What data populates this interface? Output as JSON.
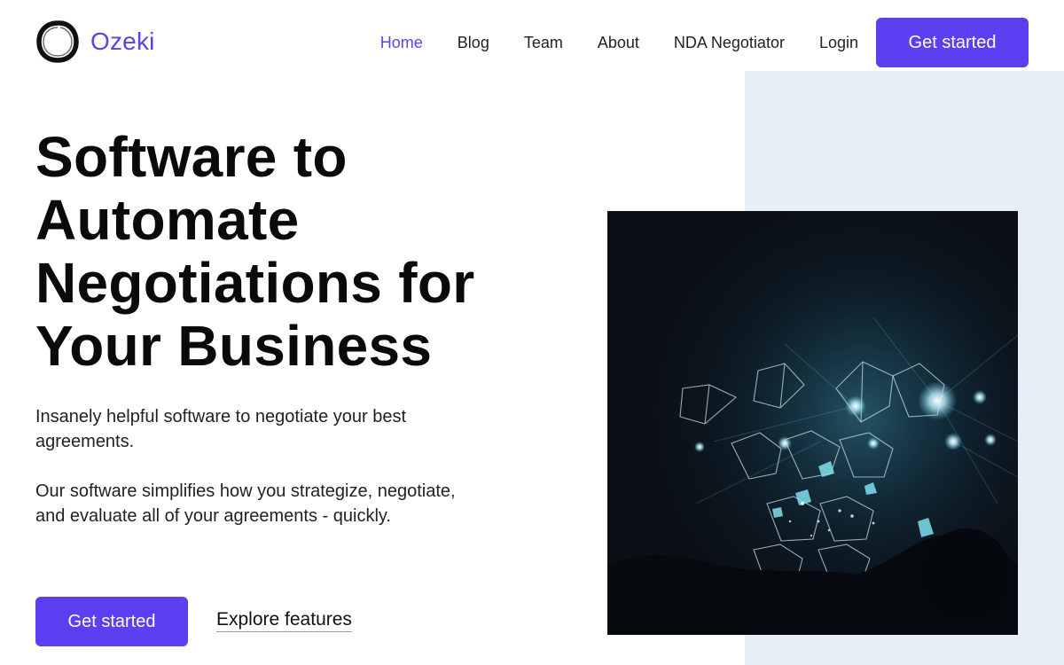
{
  "brand": {
    "name": "Ozeki",
    "logo_icon": "enso-circle-icon",
    "accent_color": "#5b3ff0"
  },
  "nav": {
    "items": [
      {
        "label": "Home",
        "active": true
      },
      {
        "label": "Blog",
        "active": false
      },
      {
        "label": "Team",
        "active": false
      },
      {
        "label": "About",
        "active": false
      },
      {
        "label": "NDA Negotiator",
        "active": false
      },
      {
        "label": "Login",
        "active": false
      }
    ],
    "cta_label": "Get started"
  },
  "hero": {
    "title": "Software to Automate Negotiations for Your Business",
    "subtitle": "Insanely helpful software to negotiate your best agreements.",
    "description": "Our software simplifies how you strategize, negotiate, and evaluate all of your agreements - quickly.",
    "primary_cta": "Get started",
    "secondary_cta": "Explore features",
    "image": "concert-light-installation-photo"
  },
  "colors": {
    "panel_background": "#e8eef7",
    "heading": "#0a0a0a"
  }
}
